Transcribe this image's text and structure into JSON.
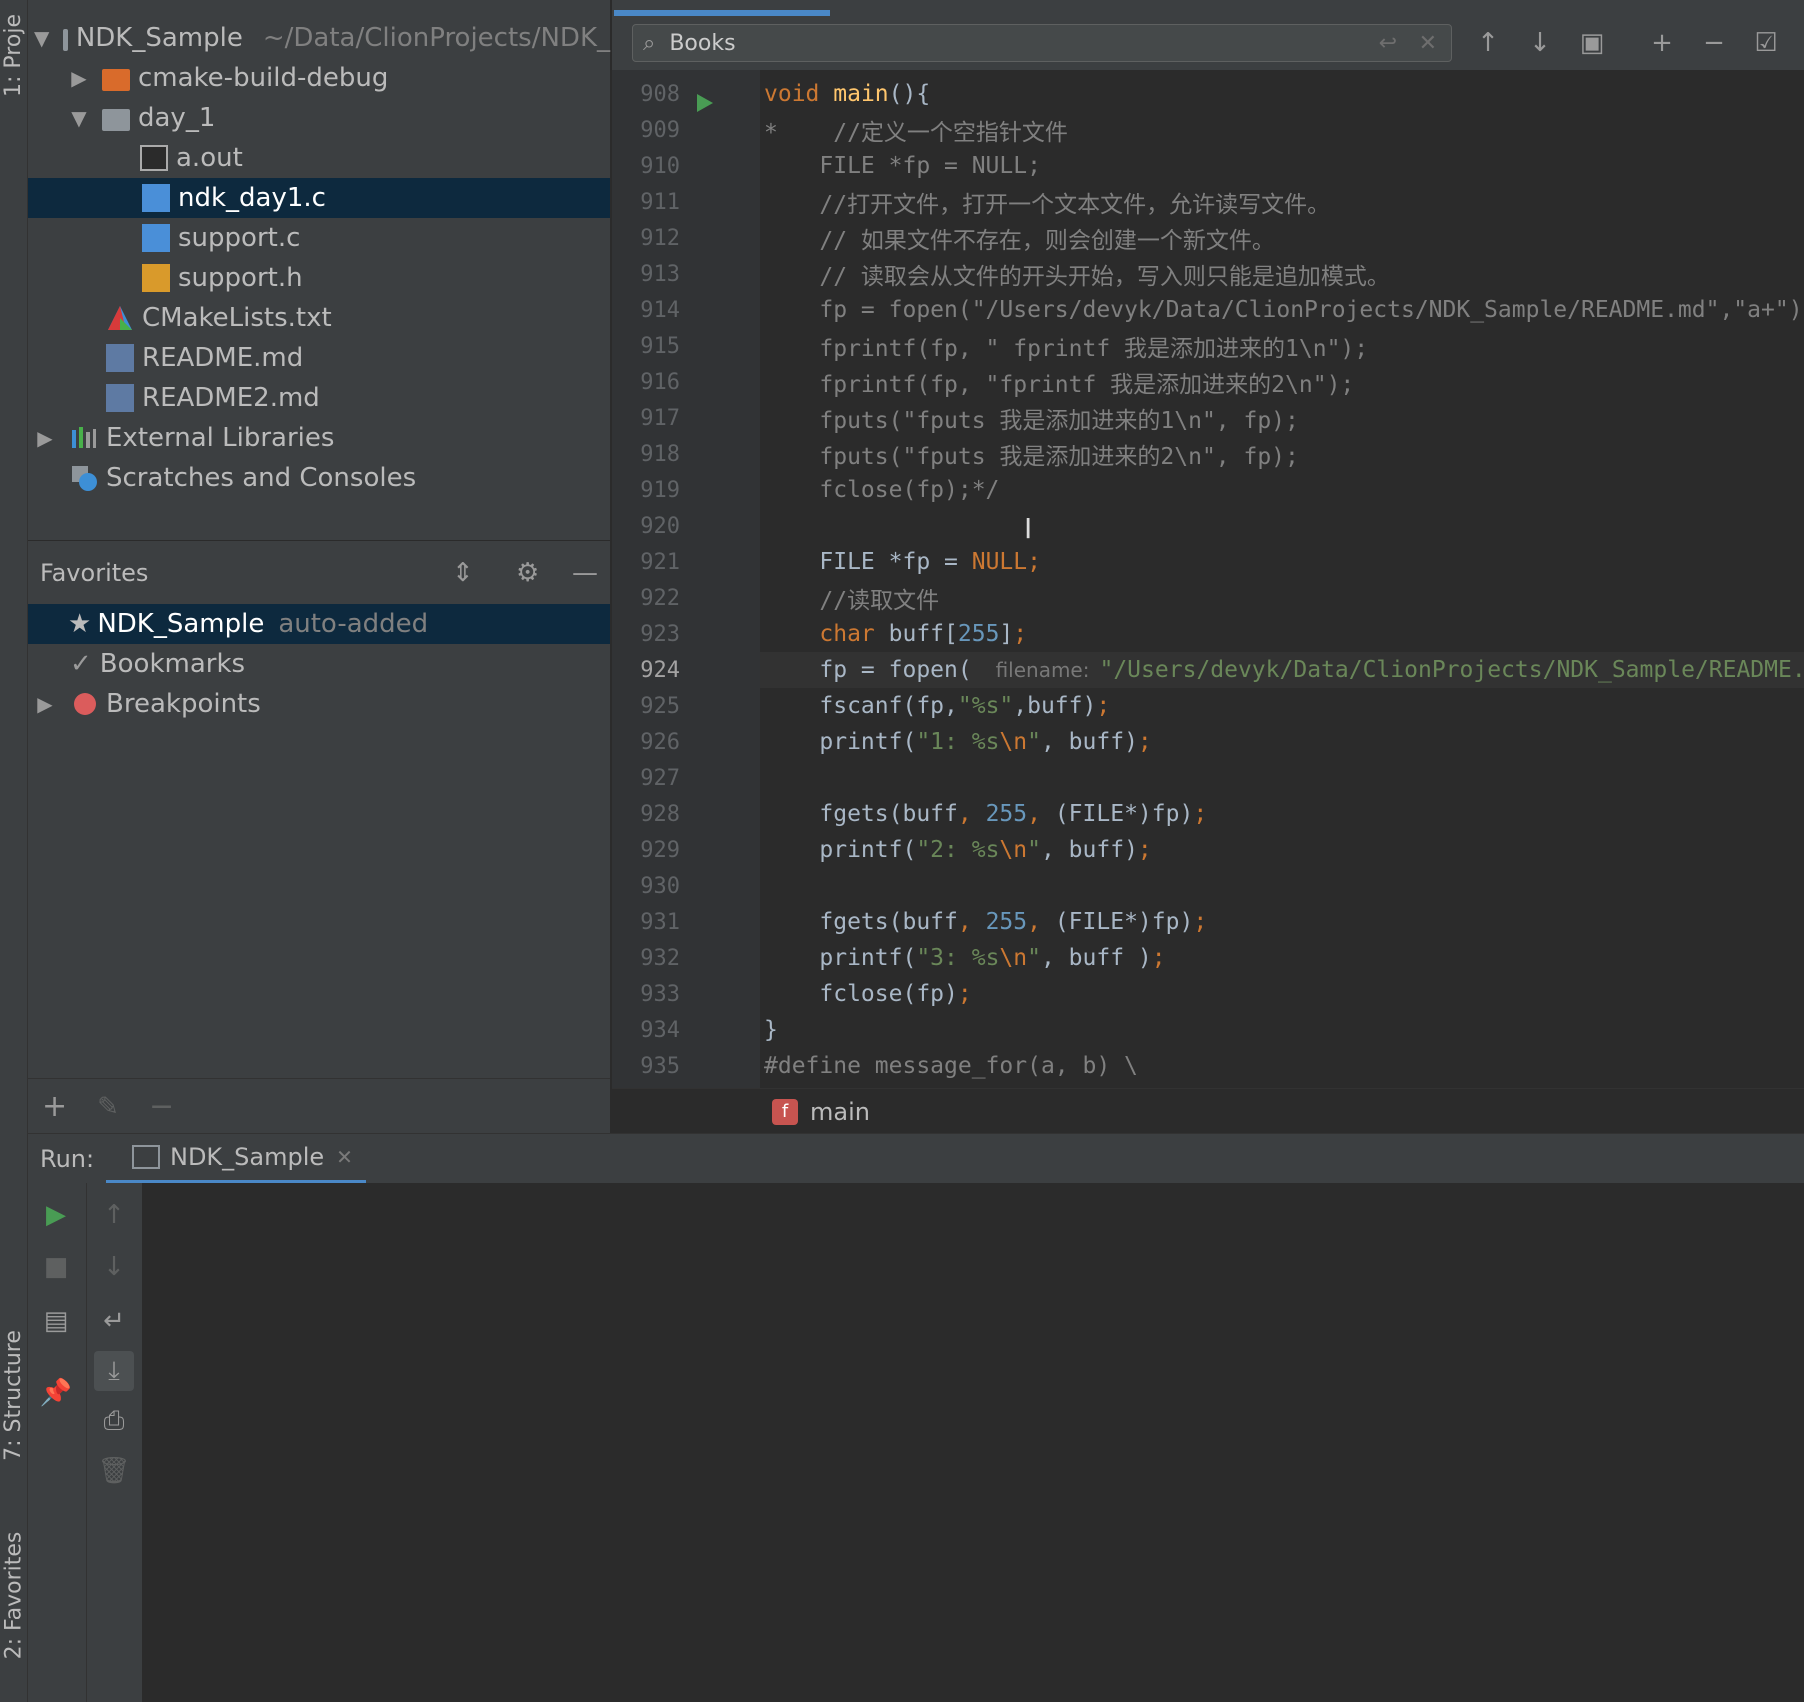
{
  "side_tabs": {
    "project": "1: Proje",
    "structure": "7: Structure",
    "favorites": "2: Favorites"
  },
  "project_tree": [
    {
      "label": "NDK_Sample",
      "extra": "~/Data/ClionProjects/NDK_",
      "icon": "folder-icon"
    },
    {
      "label": "cmake-build-debug",
      "icon": "folder-orange-icon"
    },
    {
      "label": "day_1",
      "icon": "folder-icon"
    },
    {
      "label": "a.out",
      "icon": "executable-file-icon"
    },
    {
      "label": "ndk_day1.c",
      "icon": "c-file-icon"
    },
    {
      "label": "support.c",
      "icon": "c-file-icon"
    },
    {
      "label": "support.h",
      "icon": "h-file-icon"
    },
    {
      "label": "CMakeLists.txt",
      "icon": "cmake-icon"
    },
    {
      "label": "README.md",
      "icon": "markdown-file-icon"
    },
    {
      "label": "README2.md",
      "icon": "markdown-file-icon"
    },
    {
      "label": "External Libraries",
      "icon": "libraries-icon"
    },
    {
      "label": "Scratches and Consoles",
      "icon": "scratches-icon"
    }
  ],
  "favorites": {
    "title": "Favorites",
    "items": [
      {
        "label": "NDK_Sample",
        "extra": "auto-added"
      },
      {
        "label": "Bookmarks"
      },
      {
        "label": "Breakpoints"
      }
    ]
  },
  "find": {
    "query": "Books"
  },
  "editor": {
    "line_numbers": [
      "908",
      "909",
      "910",
      "911",
      "912",
      "913",
      "914",
      "915",
      "916",
      "917",
      "918",
      "919",
      "920",
      "921",
      "922",
      "923",
      "924",
      "925",
      "926",
      "927",
      "928",
      "929",
      "930",
      "931",
      "932",
      "933",
      "934",
      "935"
    ],
    "current_line": "924",
    "lines": [
      [
        {
          "t": "void",
          "c": "kw"
        },
        {
          "t": " "
        },
        {
          "t": "main",
          "c": "fn"
        },
        {
          "t": "(){"
        }
      ],
      [
        {
          "t": "*    //定义一个空指针文件",
          "c": "cm"
        }
      ],
      [
        {
          "t": "    FILE *fp = NULL;",
          "c": "cm"
        }
      ],
      [
        {
          "t": "    //打开文件，打开一个文本文件，允许读写文件。",
          "c": "cm"
        }
      ],
      [
        {
          "t": "    // 如果文件不存在，则会创建一个新文件。",
          "c": "cm"
        }
      ],
      [
        {
          "t": "    // 读取会从文件的开头开始，写入则只能是追加模式。",
          "c": "cm"
        }
      ],
      [
        {
          "t": "    fp = fopen(\"/Users/devyk/Data/ClionProjects/NDK_Sample/README.md\",\"a+\")",
          "c": "cm"
        }
      ],
      [
        {
          "t": "    fprintf(fp, \" fprintf 我是添加进来的1\\n\");",
          "c": "cm"
        }
      ],
      [
        {
          "t": "    fprintf(fp, \"fprintf 我是添加进来的2\\n\");",
          "c": "cm"
        }
      ],
      [
        {
          "t": "    fputs(\"fputs 我是添加进来的1\\n\", fp);",
          "c": "cm"
        }
      ],
      [
        {
          "t": "    fputs(\"fputs 我是添加进来的2\\n\", fp);",
          "c": "cm"
        }
      ],
      [
        {
          "t": "    fclose(fp);*/",
          "c": "cm"
        }
      ],
      [
        {
          "t": ""
        }
      ],
      [
        {
          "t": "    FILE *fp = "
        },
        {
          "t": "NULL",
          "c": "kw"
        },
        {
          "t": ";",
          "c": "kw"
        }
      ],
      [
        {
          "t": "    //读取文件",
          "c": "cm"
        }
      ],
      [
        {
          "t": "    "
        },
        {
          "t": "char",
          "c": "kw"
        },
        {
          "t": " buff["
        },
        {
          "t": "255",
          "c": "nm"
        },
        {
          "t": "]"
        },
        {
          "t": ";",
          "c": "kw"
        }
      ],
      [
        {
          "t": "    fp = fopen( "
        },
        {
          "t": "filename:",
          "c": "hint"
        },
        {
          "t": "\"/Users/devyk/Data/ClionProjects/NDK_Sample/README.md\"",
          "c": "st"
        }
      ],
      [
        {
          "t": "    fscanf(fp,"
        },
        {
          "t": "\"%s\"",
          "c": "st"
        },
        {
          "t": ",buff)"
        },
        {
          "t": ";",
          "c": "kw"
        }
      ],
      [
        {
          "t": "    printf("
        },
        {
          "t": "\"1: %s",
          "c": "st"
        },
        {
          "t": "\\n",
          "c": "kw"
        },
        {
          "t": "\"",
          "c": "st"
        },
        {
          "t": ", buff)"
        },
        {
          "t": ";",
          "c": "kw"
        }
      ],
      [
        {
          "t": ""
        }
      ],
      [
        {
          "t": "    fgets(buff"
        },
        {
          "t": ", ",
          "c": "kw"
        },
        {
          "t": "255",
          "c": "nm"
        },
        {
          "t": ", ",
          "c": "kw"
        },
        {
          "t": "(FILE*)fp)"
        },
        {
          "t": ";",
          "c": "kw"
        }
      ],
      [
        {
          "t": "    printf("
        },
        {
          "t": "\"2: %s",
          "c": "st"
        },
        {
          "t": "\\n",
          "c": "kw"
        },
        {
          "t": "\"",
          "c": "st"
        },
        {
          "t": ", buff)"
        },
        {
          "t": ";",
          "c": "kw"
        }
      ],
      [
        {
          "t": ""
        }
      ],
      [
        {
          "t": "    fgets(buff"
        },
        {
          "t": ", ",
          "c": "kw"
        },
        {
          "t": "255",
          "c": "nm"
        },
        {
          "t": ", ",
          "c": "kw"
        },
        {
          "t": "(FILE*)fp)"
        },
        {
          "t": ";",
          "c": "kw"
        }
      ],
      [
        {
          "t": "    printf("
        },
        {
          "t": "\"3: %s",
          "c": "st"
        },
        {
          "t": "\\n",
          "c": "kw"
        },
        {
          "t": "\"",
          "c": "st"
        },
        {
          "t": ", buff )"
        },
        {
          "t": ";",
          "c": "kw"
        }
      ],
      [
        {
          "t": "    fclose(fp)"
        },
        {
          "t": ";",
          "c": "kw"
        }
      ],
      [
        {
          "t": "}"
        }
      ],
      [
        {
          "t": "#define message_for(a, b) \\",
          "c": "cm"
        }
      ]
    ]
  },
  "breadcrumb": {
    "function": "main",
    "badge": "f"
  },
  "run": {
    "label": "Run:",
    "tab": "NDK_Sample"
  },
  "colors": {
    "selection": "#0d293e",
    "accent": "#4a88c7",
    "run_green": "#499c54",
    "breakpoint_red": "#db5c5c"
  }
}
